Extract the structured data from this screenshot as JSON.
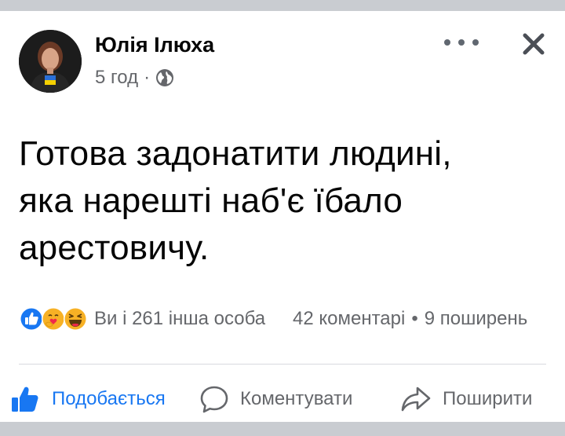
{
  "post": {
    "author": "Юлія Ілюха",
    "time": "5 год",
    "meta_separator": "·",
    "privacy_icon": "globe-icon",
    "text": "Готова задонатити людині,\nяка нарешті наб'є їбало\nарестовичу.",
    "reactions": {
      "icons": [
        "like-reaction-icon",
        "care-reaction-icon",
        "haha-reaction-icon"
      ],
      "summary": "Ви і 261 інша особа"
    },
    "stats": {
      "comments": "42 коментарі",
      "separator": "•",
      "shares": "9 поширень"
    }
  },
  "header": {
    "more_icon": "more-options-icon",
    "close_icon": "close-icon"
  },
  "actions": {
    "like": "Подобається",
    "comment": "Коментувати",
    "share": "Поширити"
  },
  "colors": {
    "accent": "#1877f2",
    "secondary_text": "#65676b",
    "primary_text": "#050505",
    "background": "#c9ccd1"
  }
}
